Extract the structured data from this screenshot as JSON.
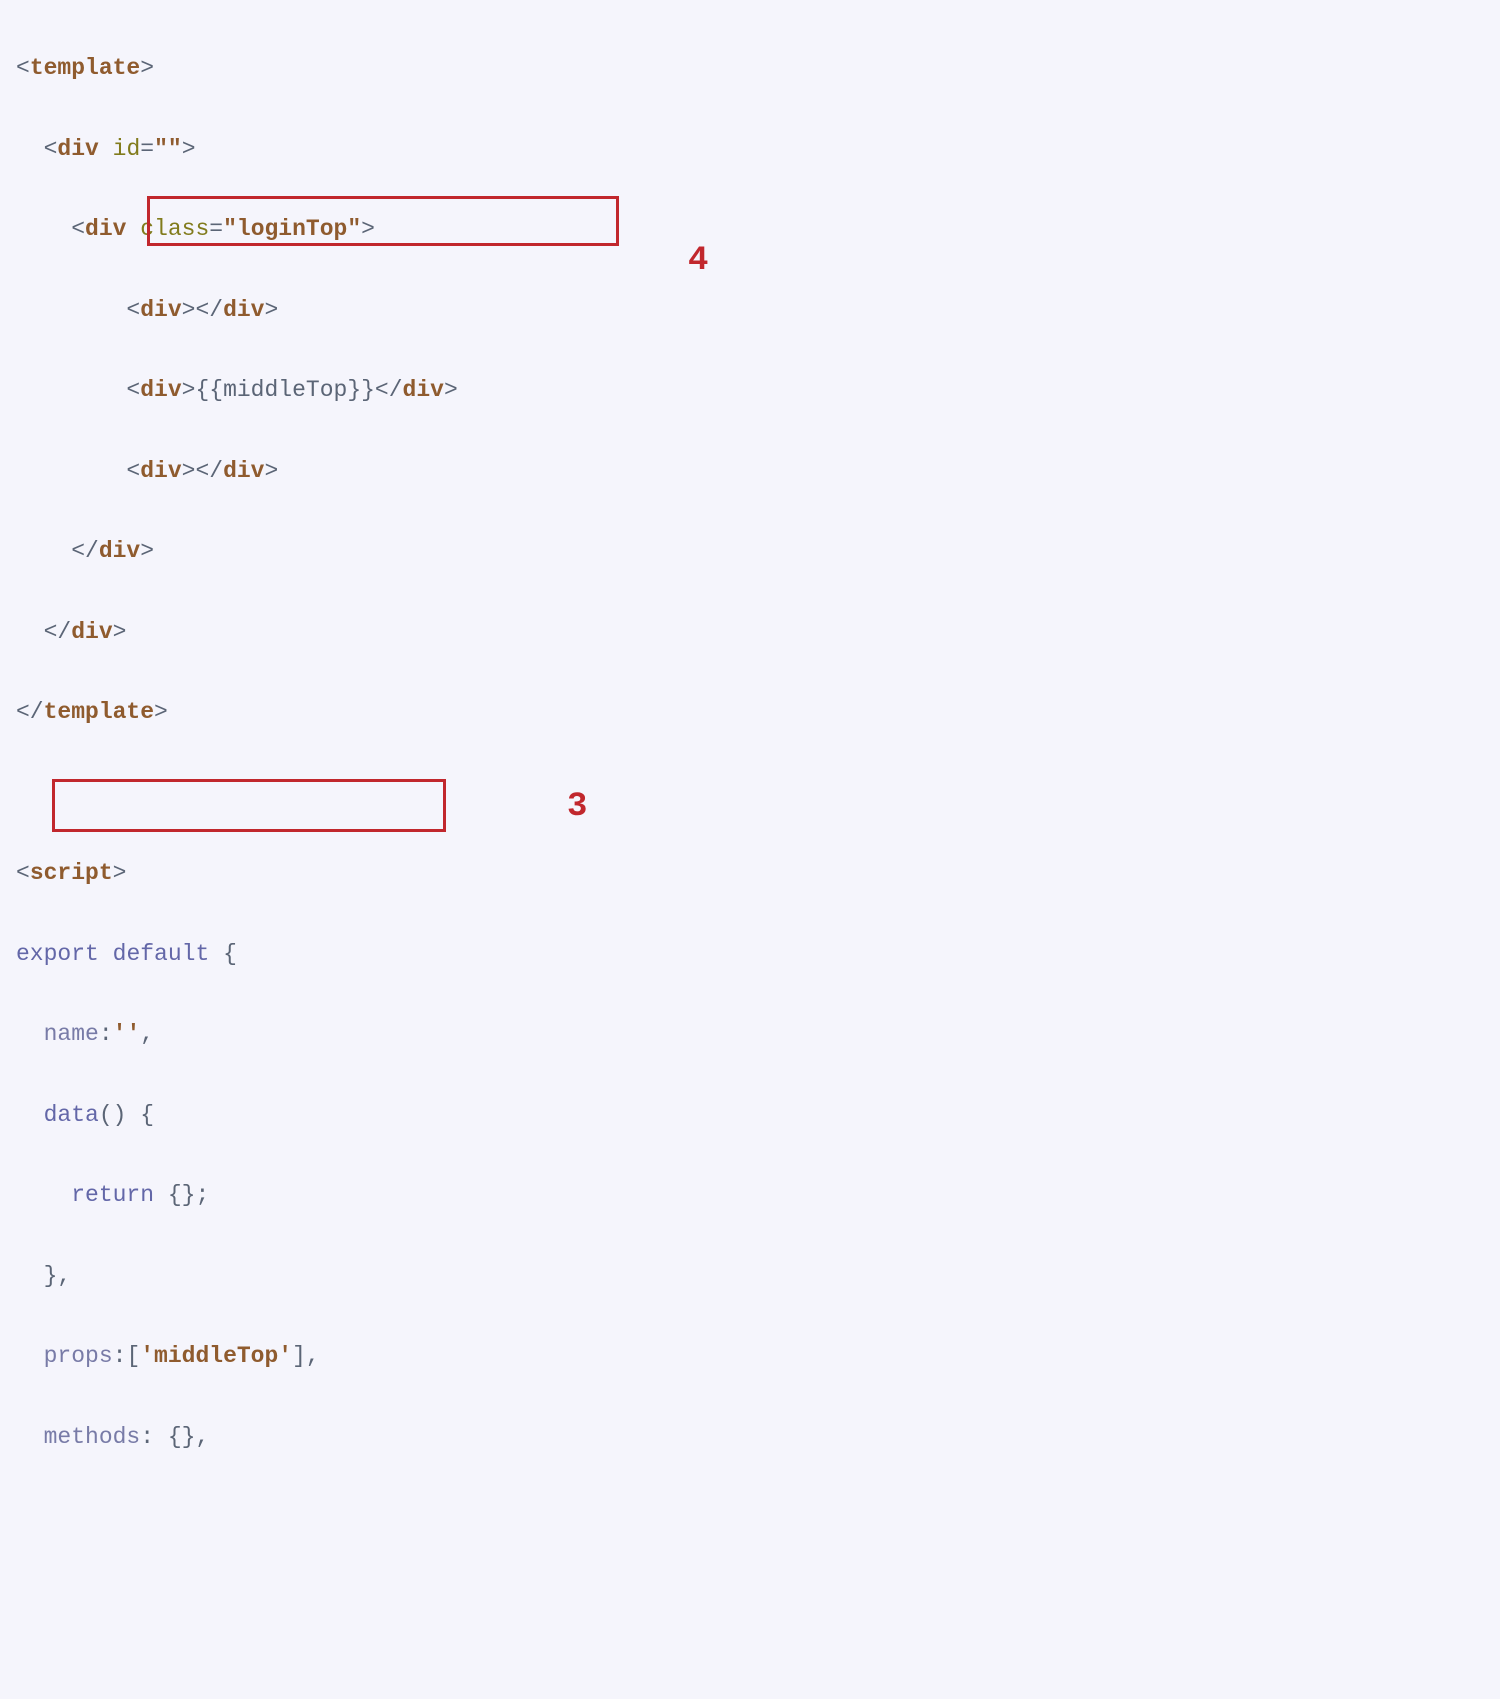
{
  "annotations": {
    "box4_label": "4",
    "box3_label": "3"
  },
  "code": {
    "l1": {
      "open_ang": "<",
      "tag": "template",
      "close_ang": ">"
    },
    "l2": {
      "open_ang": "<",
      "tag": "div",
      "attr": "id",
      "eq": "=",
      "quote": "\"\"",
      "close_ang": ">"
    },
    "l3": {
      "open_ang": "<",
      "tag": "div",
      "attr": "class",
      "eq": "=",
      "val": "\"loginTop\"",
      "close_ang": ">"
    },
    "l4": {
      "open1": "<",
      "tag1": "div",
      "close1": ">",
      "open2": "</",
      "tag2": "div",
      "close2": ">"
    },
    "l5": {
      "open1": "<",
      "tag1": "div",
      "close1": ">",
      "ms_open": "{{",
      "var": "middleTop",
      "ms_close": "}}",
      "open2": "</",
      "tag2": "div",
      "close2": ">"
    },
    "l6": {
      "open1": "<",
      "tag1": "div",
      "close1": ">",
      "open2": "</",
      "tag2": "div",
      "close2": ">"
    },
    "l7": {
      "open": "</",
      "tag": "div",
      "close": ">"
    },
    "l8": {
      "open": "</",
      "tag": "div",
      "close": ">"
    },
    "l9": {
      "open": "</",
      "tag": "template",
      "close": ">"
    },
    "l10": {
      "open": "<",
      "tag": "script",
      "close": ">"
    },
    "l11": {
      "kw1": "export",
      "kw2": "default",
      "brace": "{"
    },
    "l12": {
      "key": "name",
      "colon": ":",
      "val": "''",
      "comma": ","
    },
    "l13": {
      "fn": "data",
      "parens": "()",
      "brace": "{"
    },
    "l14": {
      "kw": "return",
      "braces": "{};"
    },
    "l15": {
      "close": "},"
    },
    "l16": {
      "key": "props",
      "colon": ":",
      "bracket_open": "[",
      "val": "'middleTop'",
      "bracket_close": "]",
      "comma": ","
    },
    "l17": {
      "key": "methods",
      "colon": ":",
      "braces": "{}",
      "comma": ","
    }
  }
}
